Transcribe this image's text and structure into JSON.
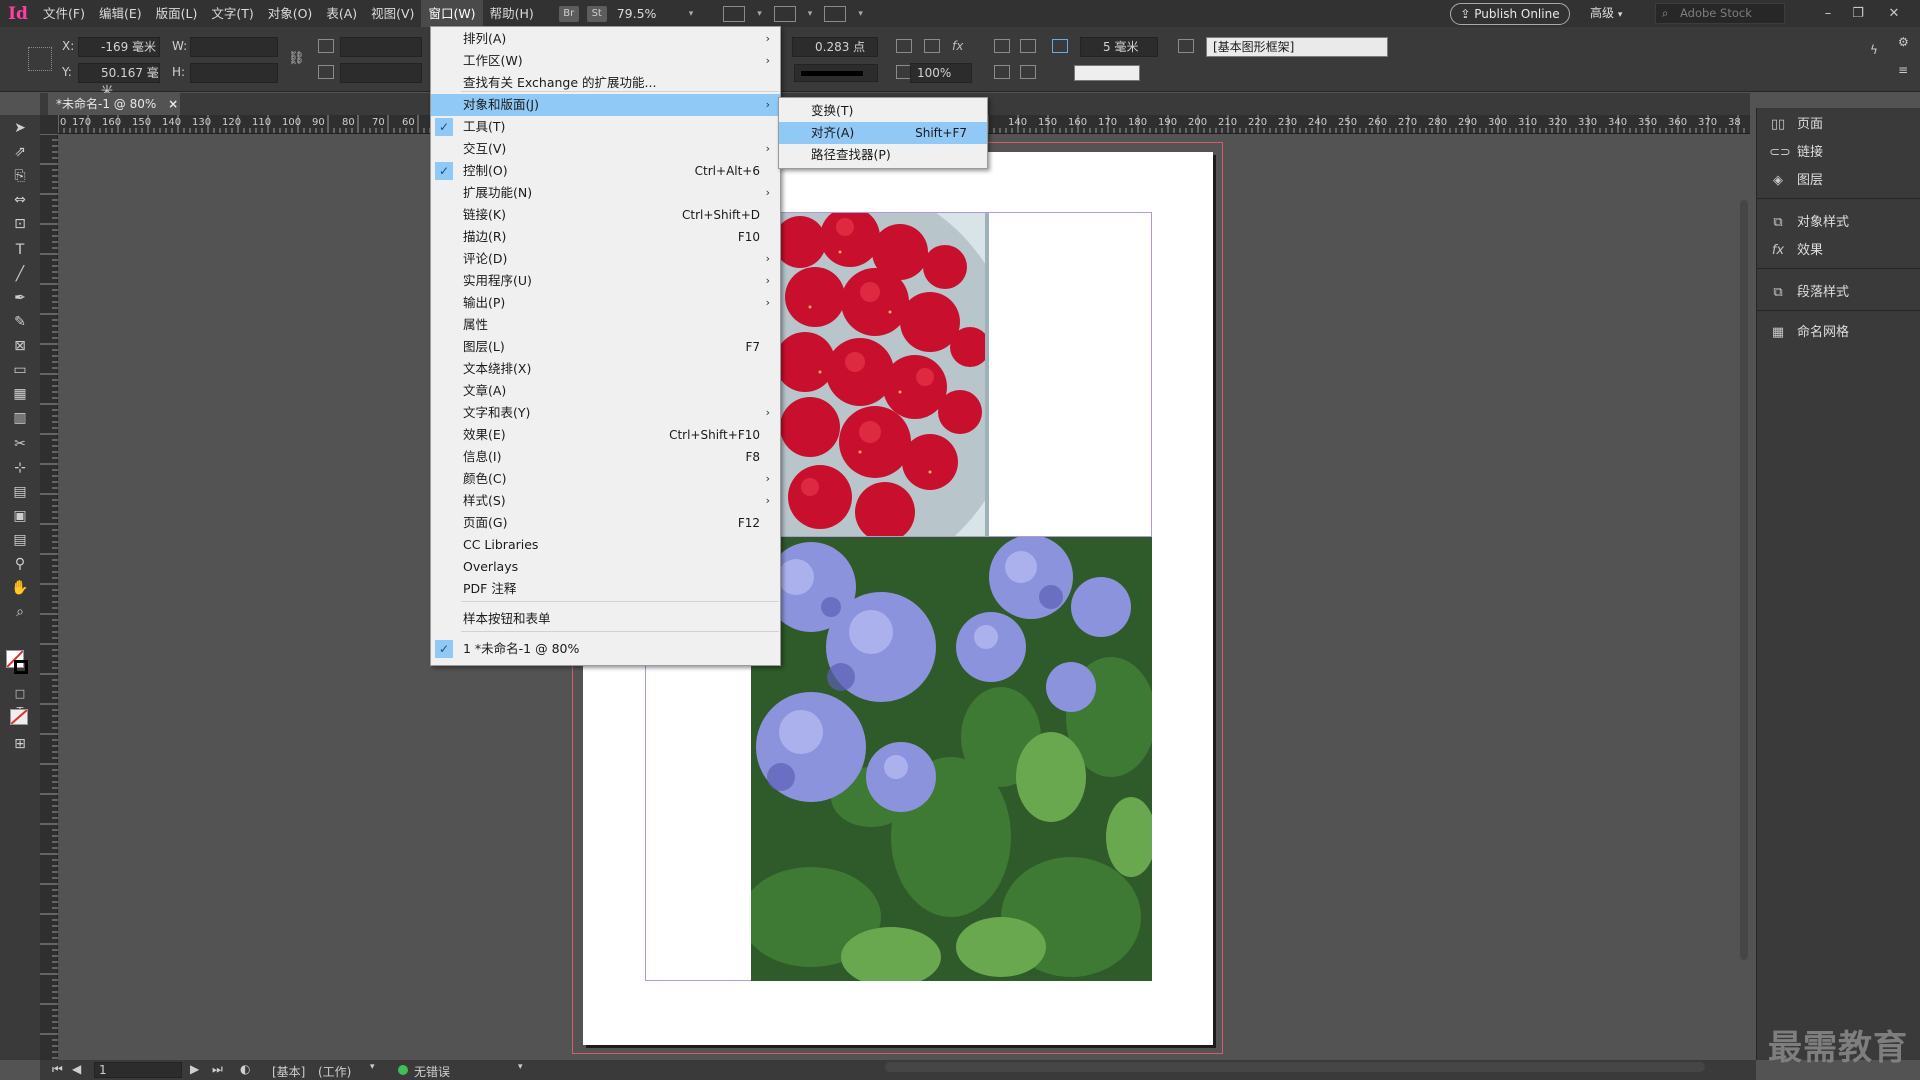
{
  "app": {
    "logo": "Id"
  },
  "menubar": {
    "items": [
      "文件(F)",
      "编辑(E)",
      "版面(L)",
      "文字(T)",
      "对象(O)",
      "表(A)",
      "视图(V)",
      "窗口(W)",
      "帮助(H)"
    ],
    "bridge": "Br",
    "stock": "St",
    "zoom": "79.5%",
    "publish": "Publish Online",
    "workspace": "高级",
    "search_placeholder": "Adobe Stock"
  },
  "control": {
    "x_label": "X:",
    "x_value": "-169 毫米",
    "y_label": "Y:",
    "y_value": "50.167 毫米",
    "w_label": "W:",
    "h_label": "H:",
    "stroke_weight": "0.283 点",
    "scale": "100%",
    "corner": "5 毫米",
    "style": "[基本图形框架]"
  },
  "tab": {
    "label": "*未命名-1 @ 80%",
    "close": "×"
  },
  "ruler": {
    "ticks": [
      "0",
      "170",
      "160",
      "150",
      "140",
      "130",
      "120",
      "110",
      "100",
      "90",
      "80",
      "70",
      "60",
      "140",
      "150",
      "160",
      "170",
      "180",
      "190",
      "200",
      "210",
      "220",
      "230",
      "240",
      "250",
      "260",
      "270",
      "280",
      "290",
      "300",
      "310",
      "320",
      "330",
      "340",
      "350",
      "360",
      "370",
      "38"
    ]
  },
  "window_menu": {
    "items": [
      {
        "label": "排列(A)",
        "shortcut": "",
        "arrow": true,
        "checked": false
      },
      {
        "label": "工作区(W)",
        "shortcut": "",
        "arrow": true,
        "checked": false
      },
      {
        "label": "查找有关 Exchange 的扩展功能...",
        "shortcut": "",
        "arrow": false,
        "checked": false
      },
      {
        "label": "对象和版面(J)",
        "shortcut": "",
        "arrow": true,
        "checked": false,
        "highlight": true
      },
      {
        "label": "工具(T)",
        "shortcut": "",
        "arrow": false,
        "checked": true
      },
      {
        "label": "交互(V)",
        "shortcut": "",
        "arrow": true,
        "checked": false
      },
      {
        "label": "控制(O)",
        "shortcut": "Ctrl+Alt+6",
        "arrow": false,
        "checked": true
      },
      {
        "label": "扩展功能(N)",
        "shortcut": "",
        "arrow": true,
        "checked": false
      },
      {
        "label": "链接(K)",
        "shortcut": "Ctrl+Shift+D",
        "arrow": false,
        "checked": false
      },
      {
        "label": "描边(R)",
        "shortcut": "F10",
        "arrow": false,
        "checked": false
      },
      {
        "label": "评论(D)",
        "shortcut": "",
        "arrow": true,
        "checked": false
      },
      {
        "label": "实用程序(U)",
        "shortcut": "",
        "arrow": true,
        "checked": false
      },
      {
        "label": "输出(P)",
        "shortcut": "",
        "arrow": true,
        "checked": false
      },
      {
        "label": "属性",
        "shortcut": "",
        "arrow": false,
        "checked": false
      },
      {
        "label": "图层(L)",
        "shortcut": "F7",
        "arrow": false,
        "checked": false
      },
      {
        "label": "文本绕排(X)",
        "shortcut": "",
        "arrow": false,
        "checked": false
      },
      {
        "label": "文章(A)",
        "shortcut": "",
        "arrow": false,
        "checked": false
      },
      {
        "label": "文字和表(Y)",
        "shortcut": "",
        "arrow": true,
        "checked": false
      },
      {
        "label": "效果(E)",
        "shortcut": "Ctrl+Shift+F10",
        "arrow": false,
        "checked": false
      },
      {
        "label": "信息(I)",
        "shortcut": "F8",
        "arrow": false,
        "checked": false
      },
      {
        "label": "颜色(C)",
        "shortcut": "",
        "arrow": true,
        "checked": false
      },
      {
        "label": "样式(S)",
        "shortcut": "",
        "arrow": true,
        "checked": false
      },
      {
        "label": "页面(G)",
        "shortcut": "F12",
        "arrow": false,
        "checked": false
      },
      {
        "label": "CC Libraries",
        "shortcut": "",
        "arrow": false,
        "checked": false
      },
      {
        "label": "Overlays",
        "shortcut": "",
        "arrow": false,
        "checked": false
      },
      {
        "label": "PDF 注释",
        "shortcut": "",
        "arrow": false,
        "checked": false
      },
      {
        "label": "样本按钮和表单",
        "shortcut": "",
        "arrow": false,
        "checked": false
      },
      {
        "label": "1 *未命名-1 @ 80%",
        "shortcut": "",
        "arrow": false,
        "checked": true
      }
    ]
  },
  "submenu": {
    "items": [
      {
        "label": "变换(T)",
        "shortcut": "",
        "highlight": false
      },
      {
        "label": "对齐(A)",
        "shortcut": "Shift+F7",
        "highlight": true
      },
      {
        "label": "路径查找器(P)",
        "shortcut": "",
        "highlight": false
      }
    ]
  },
  "panel": {
    "items": [
      {
        "label": "页面",
        "icon": "pages-icon"
      },
      {
        "label": "链接",
        "icon": "links-icon"
      },
      {
        "label": "图层",
        "icon": "layers-icon"
      },
      {
        "label": "对象样式",
        "icon": "object-styles-icon"
      },
      {
        "label": "效果",
        "icon": "effects-icon"
      },
      {
        "label": "段落样式",
        "icon": "paragraph-styles-icon"
      },
      {
        "label": "命名网格",
        "icon": "named-grid-icon"
      }
    ]
  },
  "status": {
    "page": "1",
    "base": "[基本]",
    "mode": "(工作)",
    "errors": "无错误"
  },
  "watermark": "最需教育",
  "colors": {
    "accent": "#90c8f6",
    "bleed": "#d75c6b",
    "frame": "#b497d6",
    "ok": "#3fbf55"
  }
}
